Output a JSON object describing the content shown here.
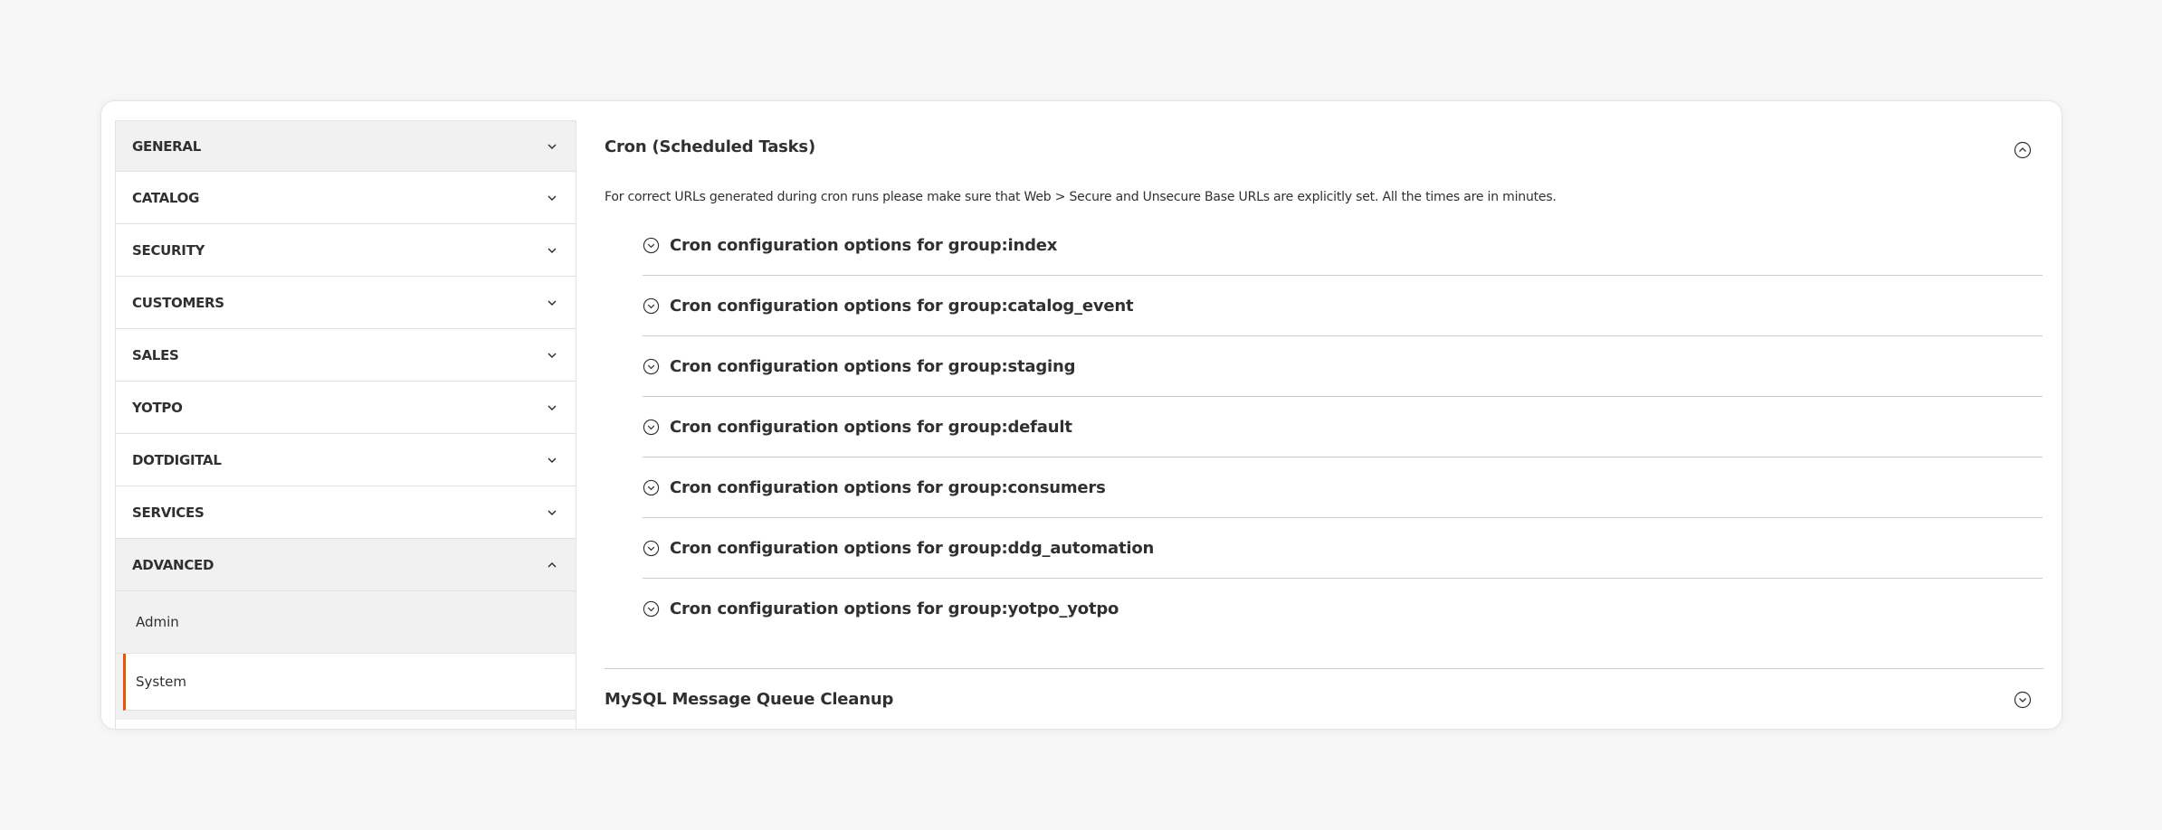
{
  "sidebar": {
    "items": [
      {
        "label": "GENERAL"
      },
      {
        "label": "CATALOG"
      },
      {
        "label": "SECURITY"
      },
      {
        "label": "CUSTOMERS"
      },
      {
        "label": "SALES"
      },
      {
        "label": "YOTPO"
      },
      {
        "label": "DOTDIGITAL"
      },
      {
        "label": "SERVICES"
      },
      {
        "label": "ADVANCED"
      }
    ],
    "advanced_sub": [
      {
        "label": "Admin"
      },
      {
        "label": "System"
      }
    ]
  },
  "main": {
    "cron_section": {
      "title": "Cron (Scheduled Tasks)",
      "description": "For correct URLs generated during cron runs please make sure that Web > Secure and Unsecure Base URLs are explicitly set. All the times are in minutes.",
      "groups": [
        {
          "label": "Cron configuration options for group:index"
        },
        {
          "label": "Cron configuration options for group:catalog_event"
        },
        {
          "label": "Cron configuration options for group:staging"
        },
        {
          "label": "Cron configuration options for group:default"
        },
        {
          "label": "Cron configuration options for group:consumers"
        },
        {
          "label": "Cron configuration options for group:ddg_automation"
        },
        {
          "label": "Cron configuration options for group:yotpo_yotpo"
        }
      ]
    },
    "mysql_section": {
      "title": "MySQL Message Queue Cleanup"
    }
  },
  "colors": {
    "accent": "#eb5202",
    "text": "#303030",
    "sidebar_bg": "#f1f1f1"
  },
  "icons": {
    "chevron_down": "chevron-down-icon",
    "chevron_up": "chevron-up-icon",
    "collapse": "circle-chevron-up-icon",
    "expand": "circle-chevron-down-icon"
  }
}
